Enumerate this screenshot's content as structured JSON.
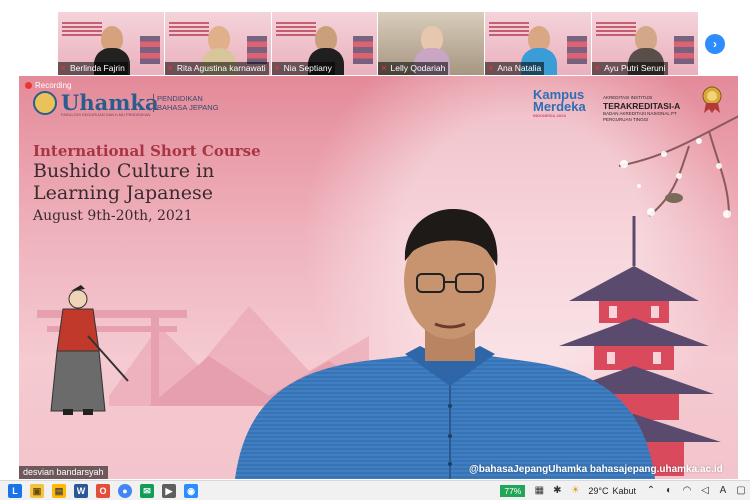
{
  "participants": [
    {
      "name": "Berlinda Fajrin"
    },
    {
      "name": "Rita Agustina karnawati"
    },
    {
      "name": "Nia Septiany"
    },
    {
      "name": "Lelly Qodariah"
    },
    {
      "name": "Ana Natalia"
    },
    {
      "name": "Ayu Putri Seruni"
    }
  ],
  "next_page_glyph": "›",
  "recording_label": "Recording",
  "banner": {
    "brand": "Uhamka",
    "brand_tagline": "FAKULTAS KEGURUAN DAN ILMU PENDIDIKAN",
    "department": "PENDIDIKAN BAHASA JEPANG",
    "merdeka_title": "Kampus Merdeka",
    "merdeka_sub": "INDONESIA JAYA",
    "accreditation_top": "AKREDITASI INSTITUSI",
    "accreditation_main": "TERAKREDITASI-A",
    "accreditation_sub1": "BADAN AKREDITASI NASIONAL PT",
    "accreditation_sub2": "PERGURUAN TINGGI",
    "course_label": "International Short Course",
    "course_title_line1": "Bushido Culture in",
    "course_title_line2": "Learning Japanese",
    "course_dates": "August 9th-20th, 2021",
    "footer_handle": "@bahasaJepangUhamka  bahasajepang.uhamka.ac.id"
  },
  "speaker_name": "desvian bandarsyah",
  "taskbar": {
    "battery": "77%",
    "temperature": "29°C",
    "weather": "Kabut",
    "apps": [
      "search",
      "file-explorer",
      "edge",
      "word",
      "chrome",
      "zoom",
      "email",
      "media",
      "camera"
    ]
  },
  "colors": {
    "accent": "#2d8cff",
    "banner_pink": "#efb3bd",
    "title_red": "#a83545",
    "battery_green": "#22a559"
  }
}
